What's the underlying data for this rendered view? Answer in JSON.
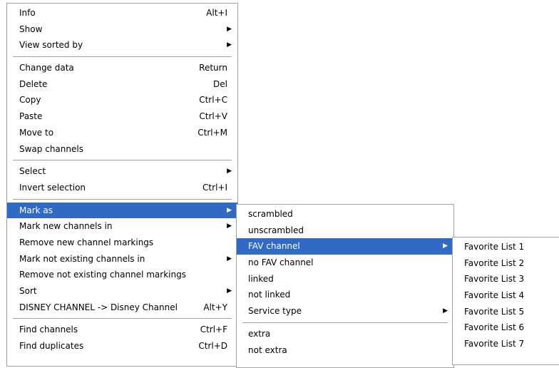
{
  "main_menu": [
    {
      "label": "Info",
      "shortcut": "Alt+I"
    },
    {
      "label": "Show",
      "arrow": "▶"
    },
    {
      "label": "View sorted by",
      "arrow": "▶"
    },
    {
      "label": "Change data",
      "shortcut": "Return"
    },
    {
      "label": "Delete",
      "shortcut": "Del"
    },
    {
      "label": "Copy",
      "shortcut": "Ctrl+C"
    },
    {
      "label": "Paste",
      "shortcut": "Ctrl+V"
    },
    {
      "label": "Move to",
      "shortcut": "Ctrl+M"
    },
    {
      "label": "Swap channels"
    },
    {
      "label": "Select",
      "arrow": "▶"
    },
    {
      "label": "Invert selection",
      "shortcut": "Ctrl+I"
    },
    {
      "label": "Mark as",
      "arrow": "▶"
    },
    {
      "label": "Mark new channels in",
      "arrow": "▶"
    },
    {
      "label": "Remove new channel markings"
    },
    {
      "label": "Mark not existing channels in",
      "arrow": "▶"
    },
    {
      "label": "Remove not existing channel markings"
    },
    {
      "label": "Sort",
      "arrow": "▶"
    },
    {
      "label": "DISNEY CHANNEL -> Disney Channel",
      "shortcut": "Alt+Y"
    },
    {
      "label": "Find channels",
      "shortcut": "Ctrl+F"
    },
    {
      "label": "Find duplicates",
      "shortcut": "Ctrl+D"
    }
  ],
  "mark_as_menu": [
    {
      "label": "scrambled"
    },
    {
      "label": "unscrambled"
    },
    {
      "label": "FAV channel",
      "arrow": "▶"
    },
    {
      "label": "no FAV channel"
    },
    {
      "label": "linked"
    },
    {
      "label": "not linked"
    },
    {
      "label": "Service type",
      "arrow": "▶"
    },
    {
      "label": "extra"
    },
    {
      "label": "not extra"
    }
  ],
  "fav_menu": [
    {
      "label": "Favorite List 1"
    },
    {
      "label": "Favorite List 2"
    },
    {
      "label": "Favorite List 3"
    },
    {
      "label": "Favorite List 4"
    },
    {
      "label": "Favorite List 5"
    },
    {
      "label": "Favorite List 6"
    },
    {
      "label": "Favorite List 7"
    }
  ],
  "colors": {
    "highlight": "#316ac5",
    "border": "#a0a0a0"
  }
}
